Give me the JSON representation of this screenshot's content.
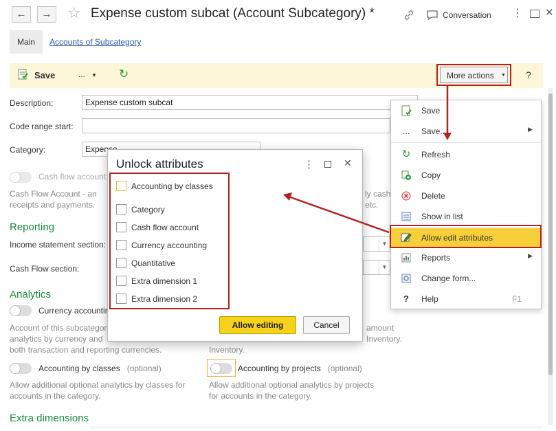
{
  "window": {
    "title": "Expense custom subcat (Account Subcategory) *",
    "conversation_label": "Conversation"
  },
  "tabs": {
    "main": "Main",
    "accounts": "Accounts of Subcategory"
  },
  "toolbar": {
    "save_label": "Save",
    "more_dots": "...",
    "more_actions_label": "More actions",
    "help": "?"
  },
  "form": {
    "description_label": "Description:",
    "description_value": "Expense custom subcat",
    "code_range_label": "Code range start:",
    "code_range_value": "",
    "category_label": "Category:",
    "category_value": "Expense",
    "cash_flow_toggle_label": "Cash flow account",
    "cash_flow_note_left": "Cash Flow Account - an\nreceipts and payments.",
    "cash_flow_note_right": "ly cash\netc.",
    "reporting_heading": "Reporting",
    "income_section_label": "Income statement section:",
    "cash_flow_section_label": "Cash Flow section:",
    "analytics_heading": "Analytics",
    "currency_toggle_label": "Currency accounting",
    "currency_note_left": "Account of this subcategory\nanalytics by currency and\nboth transaction and reporting currencies.",
    "currency_note_right": "amount\nInventory.",
    "classes_toggle_label": "Accounting by classes",
    "classes_optional": "(optional)",
    "classes_note": "Allow additional optional analytics by classes for\naccounts in the category.",
    "projects_toggle_label": "Accounting by projects",
    "projects_optional": "(optional)",
    "projects_note": "Allow additional optional analytics by projects\nfor accounts in the category.",
    "extra_dimensions_heading": "Extra dimensions"
  },
  "menu": {
    "items": [
      {
        "label": "Save",
        "icon": "save-icon"
      },
      {
        "label": "Save...",
        "icon": "dots-icon",
        "submenu": true
      },
      {
        "label": "Refresh",
        "icon": "refresh-icon"
      },
      {
        "label": "Copy",
        "icon": "copy-icon"
      },
      {
        "label": "Delete",
        "icon": "delete-icon"
      },
      {
        "label": "Show in list",
        "icon": "list-icon"
      },
      {
        "label": "Allow edit attributes",
        "icon": "edit-icon",
        "highlighted": true
      },
      {
        "label": "Reports",
        "icon": "reports-icon",
        "submenu": true
      },
      {
        "label": "Change form...",
        "icon": "form-icon"
      },
      {
        "label": "Help",
        "icon": "help-icon",
        "hotkey": "F1"
      }
    ]
  },
  "dialog": {
    "title": "Unlock attributes",
    "checkboxes": [
      {
        "label": "Accounting by classes",
        "checked": false
      },
      {
        "label": "Category",
        "checked": false
      },
      {
        "label": "Cash flow account",
        "checked": false
      },
      {
        "label": "Currency accounting",
        "checked": false
      },
      {
        "label": "Quantitative",
        "checked": false
      },
      {
        "label": "Extra dimension 1",
        "checked": false
      },
      {
        "label": "Extra dimension 2",
        "checked": false
      }
    ],
    "allow_button": "Allow editing",
    "cancel_button": "Cancel"
  },
  "colors": {
    "accent_green": "#1a8a3d",
    "toolbar_bg": "#fdf6d9",
    "highlight_yellow": "#f6cf3a",
    "annotation_red": "#b22222",
    "link_blue": "#2a57a8"
  }
}
